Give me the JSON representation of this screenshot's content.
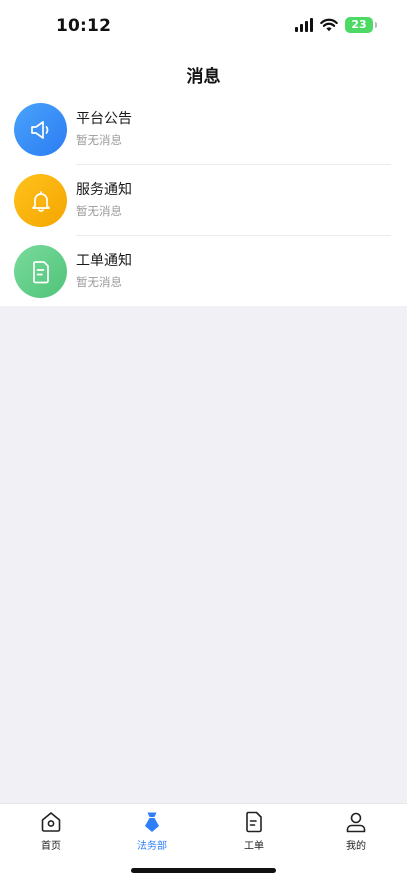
{
  "status_bar": {
    "time": "10:12",
    "battery": "23"
  },
  "header": {
    "title": "消息"
  },
  "messages": [
    {
      "title": "平台公告",
      "subtitle": "暂无消息",
      "icon": "speaker-icon",
      "color": "#3a8ff7"
    },
    {
      "title": "服务通知",
      "subtitle": "暂无消息",
      "icon": "bell-icon",
      "color": "#f7b20f"
    },
    {
      "title": "工单通知",
      "subtitle": "暂无消息",
      "icon": "document-icon",
      "color": "#62d08a"
    }
  ],
  "tab_bar": {
    "items": [
      {
        "label": "首页",
        "icon": "home-icon",
        "active": false
      },
      {
        "label": "法务部",
        "icon": "legal-tie-icon",
        "active": true
      },
      {
        "label": "工单",
        "icon": "document-icon",
        "active": false
      },
      {
        "label": "我的",
        "icon": "user-icon",
        "active": false
      }
    ],
    "active_color": "#2d7ff9"
  }
}
